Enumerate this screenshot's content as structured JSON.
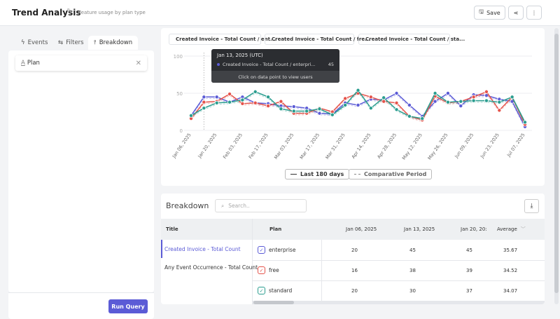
{
  "header": {
    "title": "Trend Analysis",
    "subtitle": "Feature usage by plan type",
    "save_label": "Save"
  },
  "left": {
    "tabs": [
      {
        "label": "Events",
        "icon": "bolt-icon"
      },
      {
        "label": "Filters",
        "icon": "sliders-icon"
      },
      {
        "label": "Breakdown",
        "icon": "breakdown-icon"
      }
    ],
    "active_tab": "Breakdown",
    "breakdown_field": "Plan",
    "run_label": "Run Query"
  },
  "chart": {
    "legend": [
      {
        "label": "Created Invoice - Total Count / ent...",
        "color": "#5b5bd6"
      },
      {
        "label": "Created Invoice - Total Count / fre...",
        "color": "#e5534b"
      },
      {
        "label": "Created Invoice - Total Count / sta...",
        "color": "#2a9d8f"
      }
    ],
    "tooltip": {
      "date": "Jan 13, 2025 (UTC)",
      "series": "Created Invoice - Total Count / enterpri...",
      "value": "45",
      "hint": "Click on data point to view users"
    },
    "periods": {
      "current": "Last 180 days",
      "comparative": "Comparative Period"
    }
  },
  "chart_data": {
    "type": "line",
    "ylim": [
      0,
      100
    ],
    "yticks": [
      "0",
      "50",
      "100"
    ],
    "xticks": [
      "Jan 06, 2025",
      "Jan 20, 2025",
      "Feb 03, 2025",
      "Feb 17, 2025",
      "Mar 03, 2025",
      "Mar 17, 2025",
      "Mar 31, 2025",
      "Apr 14, 2025",
      "Apr 28, 2025",
      "May 12, 2025",
      "May 26, 2025",
      "Jun 09, 2025",
      "Jun 23, 2025",
      "Jul 07, 2025"
    ],
    "x_weeks": 27,
    "series": [
      {
        "name": "Created Invoice - Total Count / enterprise",
        "color": "#5b5bd6",
        "values": [
          20,
          45,
          45,
          38,
          45,
          37,
          36,
          33,
          32,
          30,
          23,
          22,
          37,
          34,
          42,
          41,
          50,
          34,
          19,
          39,
          50,
          33,
          48,
          47,
          42,
          39,
          5
        ]
      },
      {
        "name": "Created Invoice - Total Count / free",
        "color": "#e5534b",
        "values": [
          16,
          38,
          39,
          49,
          36,
          37,
          33,
          39,
          23,
          23,
          30,
          25,
          43,
          50,
          45,
          39,
          37,
          19,
          14,
          46,
          37,
          39,
          45,
          52,
          27,
          45,
          8
        ]
      },
      {
        "name": "Created Invoice - Total Count / standard",
        "color": "#2a9d8f",
        "values": [
          20,
          30,
          37,
          38,
          41,
          52,
          45,
          29,
          26,
          26,
          29,
          21,
          34,
          54,
          30,
          44,
          28,
          19,
          16,
          50,
          38,
          39,
          40,
          40,
          38,
          45,
          11
        ]
      }
    ]
  },
  "breakdown": {
    "title": "Breakdown",
    "search_placeholder": "Search..",
    "columns": [
      "Title",
      "Plan",
      "Jan 06, 2025",
      "Jan 13, 2025",
      "Jan 20, 20:",
      "Average"
    ],
    "titles": [
      "Created Invoice - Total Count",
      "Any Event Occurrence - Total Count"
    ],
    "rows": [
      {
        "plan": "enterprise",
        "color": "#5b5bd6",
        "values": [
          "20",
          "45",
          "45",
          "35.67"
        ]
      },
      {
        "plan": "free",
        "color": "#e5534b",
        "values": [
          "16",
          "38",
          "39",
          "34.52"
        ]
      },
      {
        "plan": "standard",
        "color": "#2a9d8f",
        "values": [
          "20",
          "30",
          "37",
          "34.07"
        ]
      }
    ]
  }
}
